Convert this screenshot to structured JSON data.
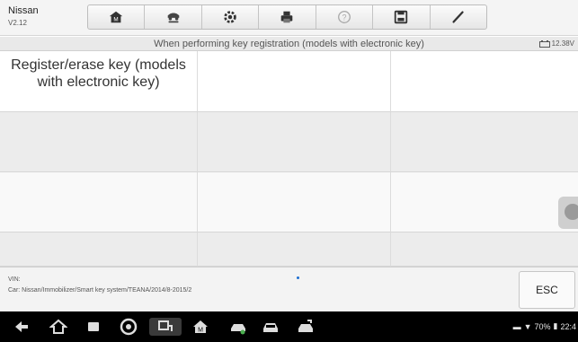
{
  "app": {
    "title": "Nissan",
    "version": "V2.12"
  },
  "toolbar": {
    "buttons": [
      {
        "icon": "home-icon"
      },
      {
        "icon": "vehicle-swap-icon"
      },
      {
        "icon": "settings-icon"
      },
      {
        "icon": "print-icon"
      },
      {
        "icon": "help-icon"
      },
      {
        "icon": "save-icon"
      },
      {
        "icon": "edit-icon"
      }
    ]
  },
  "subtitle": "When performing key registration (models with electronic key)",
  "battery": {
    "voltage": "12.38V"
  },
  "grid": {
    "rows": [
      [
        "Register/erase key (models with electronic key)",
        "",
        ""
      ],
      [
        "",
        "",
        ""
      ],
      [
        "",
        "",
        ""
      ],
      [
        "",
        "",
        ""
      ]
    ]
  },
  "footer": {
    "vin_label": "VIN:",
    "car_path": "Car: Nissan/Immobilizer/Smart key system/TEANA/2014/8-2015/2",
    "esc_label": "ESC"
  },
  "android": {
    "status": "70%",
    "time": "22:4"
  },
  "colors": {
    "header_bg": "#f4f4f4",
    "accent_dot": "#1e6fd0",
    "navbar_bg": "#000000"
  }
}
